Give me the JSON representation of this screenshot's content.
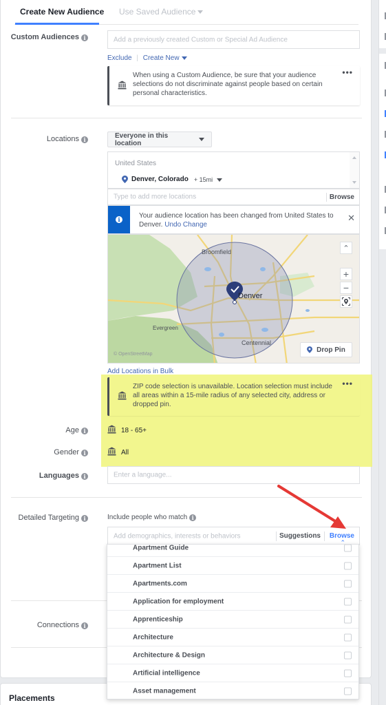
{
  "tabs": {
    "active": "Create New Audience",
    "inactive": "Use Saved Audience"
  },
  "custom_audiences": {
    "label": "Custom Audiences",
    "placeholder": "Add a previously created Custom or Special Ad Audience",
    "exclude": "Exclude",
    "create_new": "Create New",
    "notice": "When using a Custom Audience, be sure that your audience selections do not discriminate against people based on certain personal characteristics.",
    "more": "•••"
  },
  "locations": {
    "label": "Locations",
    "select": "Everyone in this location",
    "country": "United States",
    "city": "Denver, Colorado",
    "radius": "+ 15mi",
    "input_placeholder": "Type to add more locations",
    "browse": "Browse",
    "banner_text": "Your audience location has been changed from United States to Denver.",
    "undo": "Undo Change",
    "map": {
      "labels": [
        "Broomfield",
        "Denver",
        "Evergreen",
        "Centennial"
      ],
      "attribution": "© OpenStreetMap",
      "drop_pin": "Drop Pin"
    },
    "bulk": "Add Locations in Bulk",
    "zip_notice": "ZIP code selection is unavailable. Location selection must include all areas within a 15-mile radius of any selected city, address or dropped pin."
  },
  "age": {
    "label": "Age",
    "value": "18 - 65+"
  },
  "gender": {
    "label": "Gender",
    "value": "All"
  },
  "languages": {
    "label": "Languages",
    "placeholder": "Enter a language..."
  },
  "detailed_targeting": {
    "label": "Detailed Targeting",
    "include": "Include people who match",
    "placeholder": "Add demographics, interests or behaviors",
    "suggestions": "Suggestions",
    "browse": "Browse",
    "items": [
      "Apartment Guide",
      "Apartment List",
      "Apartments.com",
      "Application for employment",
      "Apprenticeship",
      "Architecture",
      "Architecture & Design",
      "Artificial intelligence",
      "Asset management"
    ]
  },
  "connections": {
    "label": "Connections"
  },
  "placements": {
    "label": "Placements"
  },
  "colors": {
    "accent": "#4080ff",
    "link": "#4267b2",
    "banner_blue": "#0a62c8",
    "highlight": "#f0f57a",
    "arrow": "#e53935"
  }
}
